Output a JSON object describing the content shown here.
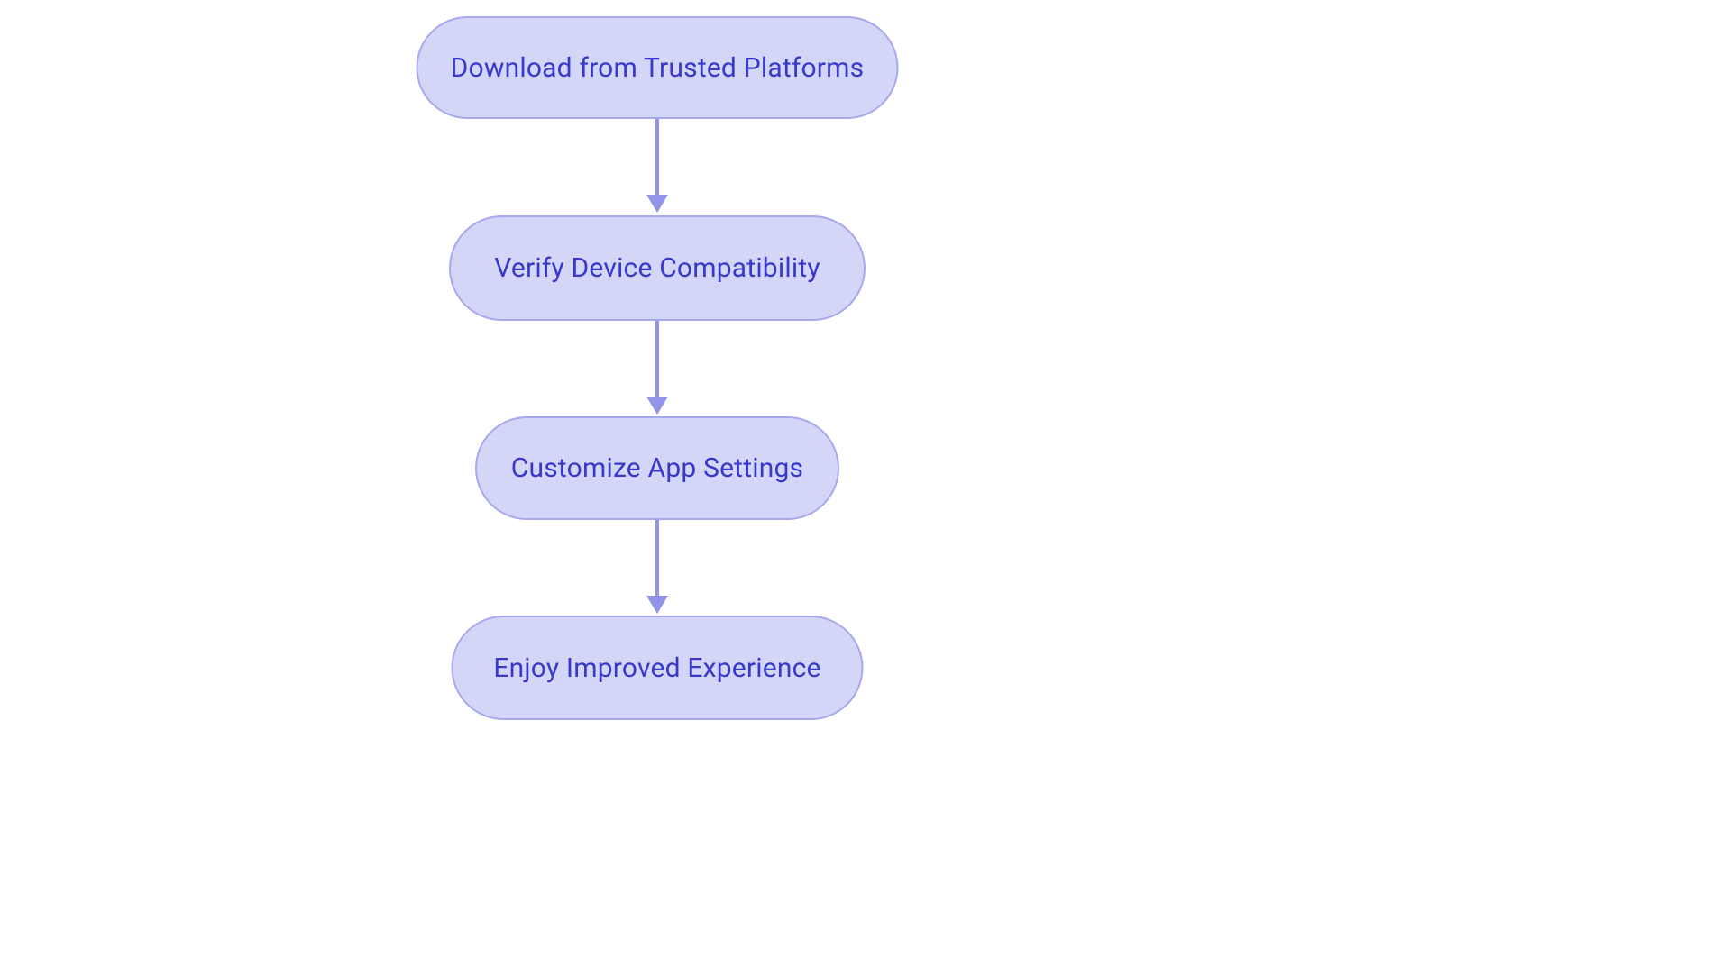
{
  "nodes": [
    {
      "label": "Download from Trusted Platforms"
    },
    {
      "label": "Verify Device Compatibility"
    },
    {
      "label": "Customize App Settings"
    },
    {
      "label": "Enjoy Improved Experience"
    }
  ],
  "colors": {
    "node_fill": "#d4d6f7",
    "node_stroke": "#a7a9ed",
    "text": "#3838c9",
    "arrow": "#9294e9"
  }
}
